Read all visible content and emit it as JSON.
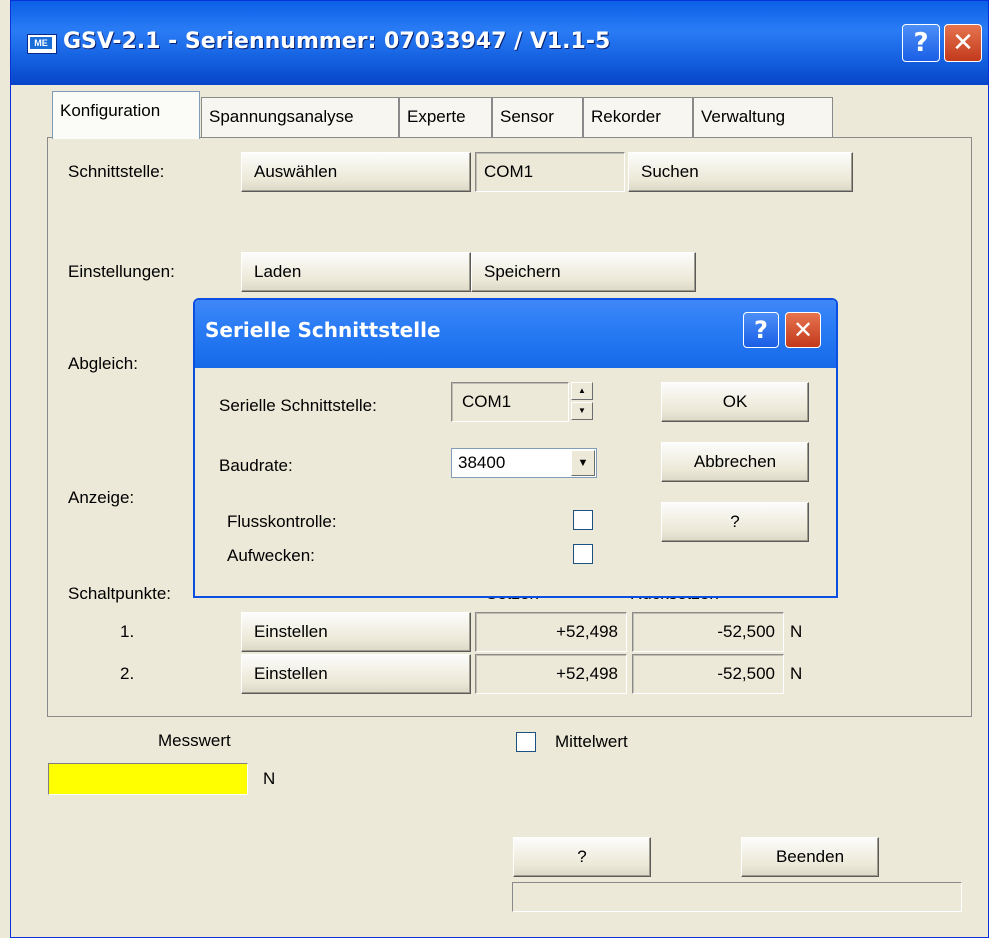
{
  "window": {
    "title": "GSV-2.1 - Seriennummer: 07033947 / V1.1-5",
    "icon_text": "ME",
    "help_label": "?",
    "close_label": "✕"
  },
  "tabs": [
    {
      "label": "Konfiguration",
      "active": true
    },
    {
      "label": "Spannungsanalyse"
    },
    {
      "label": "Experte"
    },
    {
      "label": "Sensor"
    },
    {
      "label": "Rekorder"
    },
    {
      "label": "Verwaltung"
    }
  ],
  "config": {
    "schnittstelle_label": "Schnittstelle:",
    "auswaehlen_label": "Auswählen",
    "com_value": "COM1",
    "suchen_label": "Suchen",
    "einstellungen_label": "Einstellungen:",
    "laden_label": "Laden",
    "speichern_label": "Speichern",
    "abgleich_label": "Abgleich:",
    "anzeige_label": "Anzeige:",
    "schaltpunkte_label": "Schaltpunkte:",
    "col_ein_partial": "Setzen",
    "col_aus_partial": "Rücksetzen",
    "rows": [
      {
        "num": "1.",
        "button": "Einstellen",
        "value1": "+52,498",
        "value2": "-52,500",
        "unit": "N"
      },
      {
        "num": "2.",
        "button": "Einstellen",
        "value1": "+52,498",
        "value2": "-52,500",
        "unit": "N"
      }
    ]
  },
  "bottom": {
    "messwert_label": "Messwert",
    "messwert_unit": "N",
    "messwert_color": "#ffff00",
    "mittelwert_label": "Mittelwert",
    "help_button": "?",
    "beenden_button": "Beenden"
  },
  "dialog": {
    "title": "Serielle Schnittstelle",
    "help_label": "?",
    "close_label": "✕",
    "port_label": "Serielle Schnittstelle:",
    "port_value": "COM1",
    "baud_label": "Baudrate:",
    "baud_value": "38400",
    "fluss_label": "Flusskontrolle:",
    "aufwecken_label": "Aufwecken:",
    "ok_label": "OK",
    "cancel_label": "Abbrechen",
    "help_button": "?"
  }
}
